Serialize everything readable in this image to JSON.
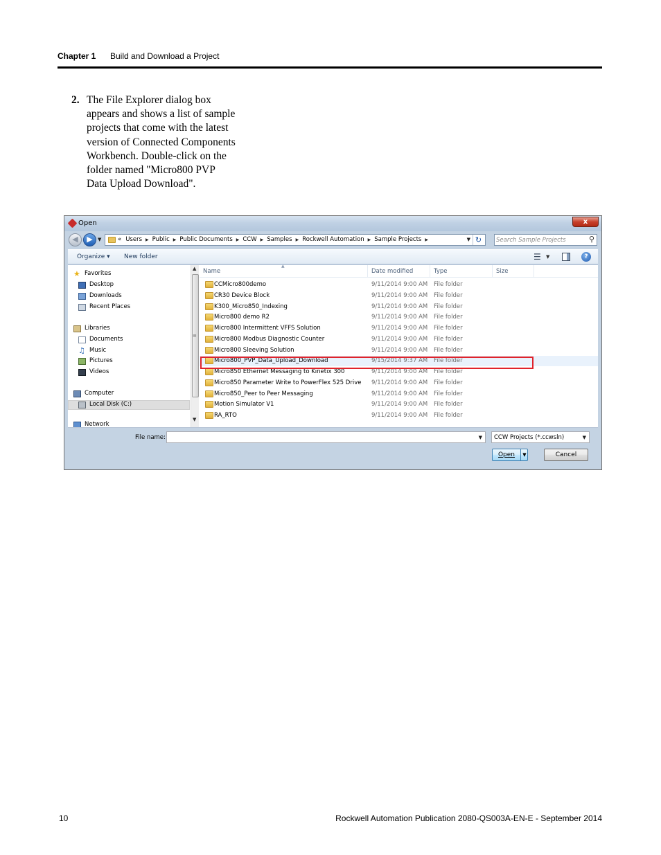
{
  "header": {
    "chapter": "Chapter 1",
    "title": "Build and Download a Project"
  },
  "step": {
    "number": "2.",
    "text": "The File Explorer dialog box appears and shows a list of sample projects that come with the latest version of Connected Components Workbench. Double-click on the folder named \"Micro800 PVP Data Upload Download\"."
  },
  "dialog": {
    "title": "Open",
    "close_symbol": "x",
    "breadcrumb": [
      "«",
      "Users",
      "Public",
      "Public Documents",
      "CCW",
      "Samples",
      "Rockwell Automation",
      "Sample Projects"
    ],
    "search_placeholder": "Search Sample Projects",
    "toolbar": {
      "organize": "Organize ▾",
      "new_folder": "New folder"
    },
    "nav": {
      "favorites": "Favorites",
      "desktop": "Desktop",
      "downloads": "Downloads",
      "recent": "Recent Places",
      "libraries": "Libraries",
      "documents": "Documents",
      "music": "Music",
      "pictures": "Pictures",
      "videos": "Videos",
      "computer": "Computer",
      "local_disk": "Local Disk (C:)",
      "network": "Network"
    },
    "columns": {
      "name": "Name",
      "date": "Date modified",
      "type": "Type",
      "size": "Size"
    },
    "files": [
      {
        "name": "CCMicro800demo",
        "date": "9/11/2014 9:00 AM",
        "type": "File folder"
      },
      {
        "name": "CR30 Device Block",
        "date": "9/11/2014 9:00 AM",
        "type": "File folder"
      },
      {
        "name": "K300_Micro850_Indexing",
        "date": "9/11/2014 9:00 AM",
        "type": "File folder"
      },
      {
        "name": "Micro800 demo R2",
        "date": "9/11/2014 9:00 AM",
        "type": "File folder"
      },
      {
        "name": "Micro800 Intermittent VFFS Solution",
        "date": "9/11/2014 9:00 AM",
        "type": "File folder"
      },
      {
        "name": "Micro800 Modbus Diagnostic Counter",
        "date": "9/11/2014 9:00 AM",
        "type": "File folder"
      },
      {
        "name": "Micro800 Sleeving Solution",
        "date": "9/11/2014 9:00 AM",
        "type": "File folder"
      },
      {
        "name": "Micro800_PVP_Data_Upload_Download",
        "date": "9/15/2014 9:37 AM",
        "type": "File folder"
      },
      {
        "name": "Micro850 Ethernet Messaging to Kinetix 300",
        "date": "9/11/2014 9:00 AM",
        "type": "File folder"
      },
      {
        "name": "Micro850 Parameter Write to PowerFlex 525 Drive",
        "date": "9/11/2014 9:00 AM",
        "type": "File folder"
      },
      {
        "name": "Micro850_Peer to Peer Messaging",
        "date": "9/11/2014 9:00 AM",
        "type": "File folder"
      },
      {
        "name": "Motion Simulator V1",
        "date": "9/11/2014 9:00 AM",
        "type": "File folder"
      },
      {
        "name": "RA_RTO",
        "date": "9/11/2014 9:00 AM",
        "type": "File folder"
      }
    ],
    "filename_label": "File name:",
    "filename_value": "",
    "filter_value": "CCW Projects (*.ccwsln)",
    "open_label": "Open",
    "cancel_label": "Cancel",
    "highlight_color": "#e0232b"
  },
  "footer": {
    "page_number": "10",
    "publication": "Rockwell Automation Publication 2080-QS003A-EN-E - September 2014"
  }
}
